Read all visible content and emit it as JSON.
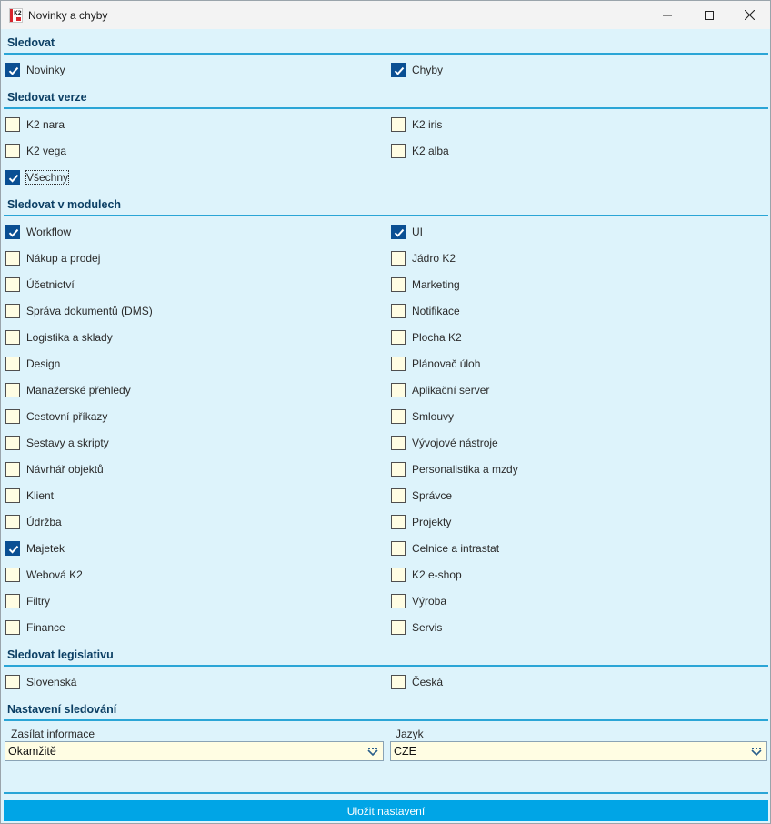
{
  "window": {
    "title": "Novinky a chyby",
    "app_icon_text": "K2"
  },
  "sections": {
    "follow": {
      "title": "Sledovat"
    },
    "versions": {
      "title": "Sledovat verze"
    },
    "modules": {
      "title": "Sledovat v modulech"
    },
    "legislation": {
      "title": "Sledovat legislativu"
    },
    "settings": {
      "title": "Nastavení sledování"
    }
  },
  "follow": [
    {
      "label": "Novinky",
      "checked": true
    },
    {
      "label": "Chyby",
      "checked": true
    }
  ],
  "versions": [
    {
      "label": "K2 nara",
      "checked": false
    },
    {
      "label": "K2 iris",
      "checked": false
    },
    {
      "label": "K2 vega",
      "checked": false
    },
    {
      "label": "K2 alba",
      "checked": false
    },
    {
      "label": "Všechny",
      "checked": true
    }
  ],
  "modules": [
    {
      "label": "Workflow",
      "checked": true
    },
    {
      "label": "UI",
      "checked": true
    },
    {
      "label": "Nákup a prodej",
      "checked": false
    },
    {
      "label": "Jádro K2",
      "checked": false
    },
    {
      "label": "Účetnictví",
      "checked": false
    },
    {
      "label": "Marketing",
      "checked": false
    },
    {
      "label": "Správa dokumentů (DMS)",
      "checked": false
    },
    {
      "label": "Notifikace",
      "checked": false
    },
    {
      "label": "Logistika a sklady",
      "checked": false
    },
    {
      "label": "Plocha K2",
      "checked": false
    },
    {
      "label": "Design",
      "checked": false
    },
    {
      "label": "Plánovač úloh",
      "checked": false
    },
    {
      "label": "Manažerské přehledy",
      "checked": false
    },
    {
      "label": "Aplikační server",
      "checked": false
    },
    {
      "label": "Cestovní příkazy",
      "checked": false
    },
    {
      "label": "Smlouvy",
      "checked": false
    },
    {
      "label": "Sestavy a skripty",
      "checked": false
    },
    {
      "label": "Vývojové nástroje",
      "checked": false
    },
    {
      "label": "Návrhář objektů",
      "checked": false
    },
    {
      "label": "Personalistika a mzdy",
      "checked": false
    },
    {
      "label": "Klient",
      "checked": false
    },
    {
      "label": "Správce",
      "checked": false
    },
    {
      "label": "Údržba",
      "checked": false
    },
    {
      "label": "Projekty",
      "checked": false
    },
    {
      "label": "Majetek",
      "checked": true
    },
    {
      "label": "Celnice a intrastat",
      "checked": false
    },
    {
      "label": "Webová K2",
      "checked": false
    },
    {
      "label": "K2 e-shop",
      "checked": false
    },
    {
      "label": "Filtry",
      "checked": false
    },
    {
      "label": "Výroba",
      "checked": false
    },
    {
      "label": "Finance",
      "checked": false
    },
    {
      "label": "Servis",
      "checked": false
    }
  ],
  "legislation": [
    {
      "label": "Slovenská",
      "checked": false
    },
    {
      "label": "Česká",
      "checked": false
    }
  ],
  "settings": {
    "send_info_label": "Zasílat informace",
    "send_info_value": "Okamžitě",
    "language_label": "Jazyk",
    "language_value": "CZE"
  },
  "save_button": "Uložit nastavení",
  "colors": {
    "window_bg": "#ddf3fb",
    "accent": "#2aa5d6",
    "header_text": "#0c3f64",
    "checked_box": "#0a4f93",
    "input_bg": "#fffde3",
    "save_bar": "#00a5e6"
  }
}
